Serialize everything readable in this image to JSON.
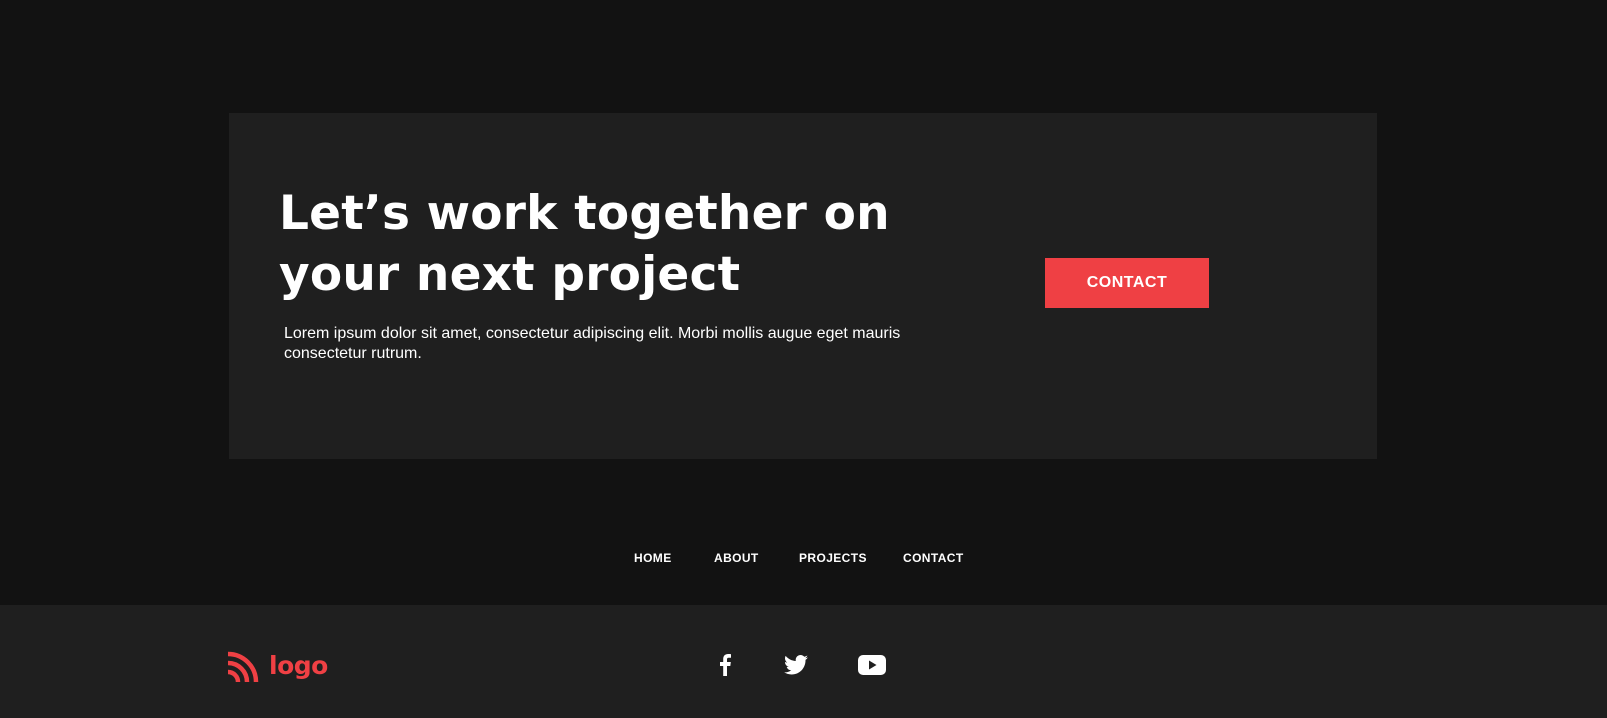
{
  "cta": {
    "heading": "Let’s work together on your next project",
    "text": "Lorem ipsum dolor sit amet, consectetur adipiscing elit. Morbi mollis augue eget mauris consectetur rutrum.",
    "button_label": "CONTACT"
  },
  "nav": {
    "items": [
      {
        "label": "HOME"
      },
      {
        "label": "ABOUT"
      },
      {
        "label": "PROJECTS"
      },
      {
        "label": "CONTACT"
      }
    ]
  },
  "footer": {
    "logo_text": "logo",
    "social": [
      {
        "icon": "facebook-icon"
      },
      {
        "icon": "twitter-icon"
      },
      {
        "icon": "youtube-icon"
      }
    ]
  },
  "colors": {
    "page_background": "#121212",
    "card_background": "#1f1f1f",
    "accent": "#ef4044",
    "text": "#ffffff"
  }
}
